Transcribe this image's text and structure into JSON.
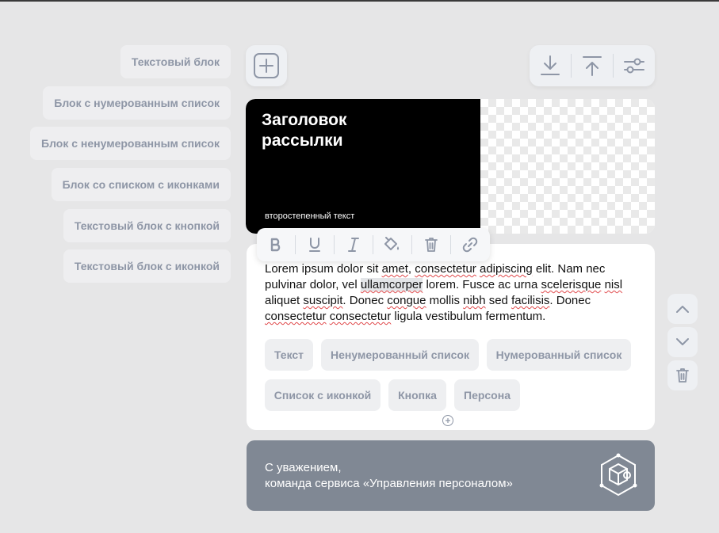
{
  "blocks": [
    "Текстовый блок",
    "Блок с нумерованным список",
    "Блок с ненумерованным список",
    "Блок со списком с иконками",
    "Текстовый блок с кнопкой",
    "Текстовый блок с иконкой"
  ],
  "toolbar": {
    "add": "plus-icon",
    "download": "download-icon",
    "upload": "upload-icon",
    "settings": "sliders-icon"
  },
  "header": {
    "title_line1": "Заголовок",
    "title_line2": "рассылки",
    "subtitle": "второстепенный текст"
  },
  "format_toolbar": [
    "bold-icon",
    "underline-icon",
    "italic-icon",
    "fill-color-icon",
    "trash-icon",
    "link-icon"
  ],
  "body_text": {
    "t1": "Lorem ipsum dolor sit ",
    "w_amet": "amet",
    "t2": ", ",
    "w_consectetur1": "consectetur",
    "t3": " ",
    "w_adipiscing": "adipiscing",
    "t4": " elit. Nam nec pulvinar dolor, vel ",
    "w_ullamcorper": "ullamcorper",
    "t5": " lorem. Fusce ac urna ",
    "w_scelerisque": "scelerisque",
    "t6": " ",
    "w_nisl": "nisl",
    "t7": " aliquet ",
    "w_suscipit": "suscipit",
    "t8": ". Donec ",
    "w_congue": "congue",
    "t9": " mollis ",
    "w_nibh": "nibh",
    "t10": " sed ",
    "w_facilisis": "facilisis",
    "t11": ". Donec ",
    "w_consectetur2": "consectetur",
    "t12": " ",
    "w_consectetur3": "consectetur",
    "t13": " ligula vestibulum fermentum."
  },
  "chips": {
    "text": "Текст",
    "unordered": "Ненумерованный список",
    "ordered": "Нумерованный список",
    "icon_list": "Список с иконкой",
    "button": "Кнопка",
    "persona": "Персона"
  },
  "side_controls": [
    "chevron-up-icon",
    "chevron-down-icon",
    "trash-icon"
  ],
  "footer": {
    "line1": "С уважением,",
    "line2": "команда сервиса «Управления персоналом»"
  },
  "colors": {
    "background": "#e6e6e7",
    "muted_text": "#8e96a6",
    "footer_bg": "#808894",
    "spellcheck": "#e0484a"
  }
}
